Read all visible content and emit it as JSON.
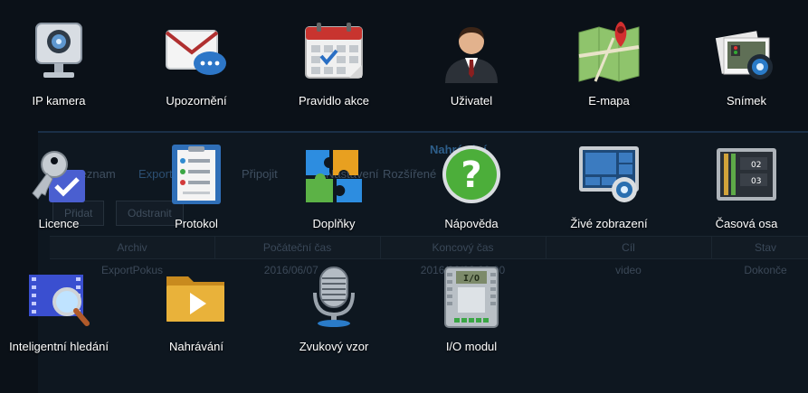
{
  "background_window": {
    "title": "Nahrávání",
    "tabs": [
      "Seznam",
      "Export",
      "Připojit",
      "Nastavení",
      "Rozšířené"
    ],
    "buttons": [
      "Přidat",
      "Odstranit"
    ],
    "columns": [
      "Archiv",
      "Počáteční čas",
      "Koncový čas",
      "Cíl",
      "Stav"
    ],
    "row": [
      "ExportPokus",
      "2016/06/07 ...",
      "2016/06/08 00:00",
      "video",
      "Dokonče"
    ]
  },
  "apps": [
    {
      "label": "IP kamera",
      "icon": "ip-camera-icon"
    },
    {
      "label": "Upozornění",
      "icon": "notification-icon"
    },
    {
      "label": "Pravidlo akce",
      "icon": "action-rule-icon"
    },
    {
      "label": "Uživatel",
      "icon": "user-icon"
    },
    {
      "label": "E-mapa",
      "icon": "e-map-icon"
    },
    {
      "label": "Snímek",
      "icon": "snapshot-icon"
    },
    {
      "label": "Licence",
      "icon": "license-icon"
    },
    {
      "label": "Protokol",
      "icon": "log-icon"
    },
    {
      "label": "Doplňky",
      "icon": "add-ons-icon"
    },
    {
      "label": "Nápověda",
      "icon": "help-icon"
    },
    {
      "label": "Živé zobrazení",
      "icon": "live-view-icon"
    },
    {
      "label": "Časová osa",
      "icon": "timeline-icon"
    },
    {
      "label": "Inteligentní hledání",
      "icon": "intelligent-search-icon"
    },
    {
      "label": "Nahrávání",
      "icon": "recording-icon"
    },
    {
      "label": "Zvukový vzor",
      "icon": "audio-pattern-icon"
    },
    {
      "label": "I/O modul",
      "icon": "io-module-icon"
    }
  ]
}
